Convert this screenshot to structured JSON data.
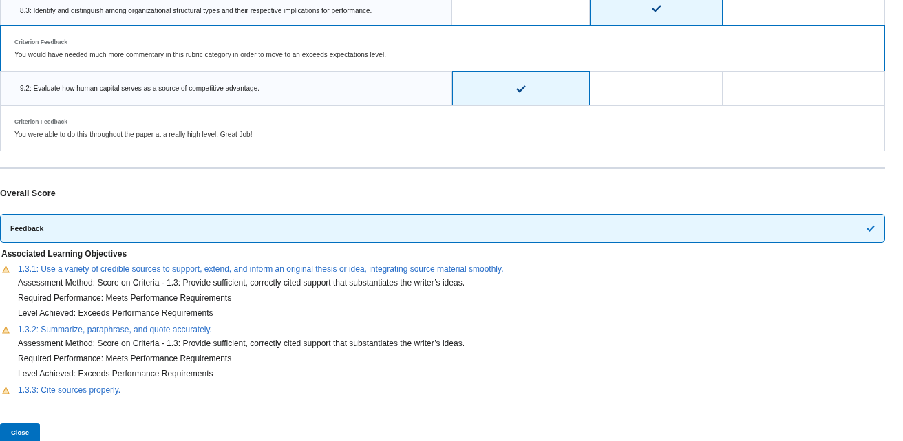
{
  "criteria": [
    {
      "name": "8.3: Identify and distinguish among organizational structural types and their respective implications for performance.",
      "levels": [
        {
          "selected": false
        },
        {
          "selected": true
        },
        {
          "selected": false
        }
      ],
      "feedback_label": "Criterion Feedback",
      "feedback": "You would have needed much more commentary in this rubric category in order to move to an exceeds expectations level.",
      "expanded": true
    },
    {
      "name": "9.2: Evaluate how human capital serves as a source of competitive advantage.",
      "levels": [
        {
          "selected": true
        },
        {
          "selected": false
        },
        {
          "selected": false
        }
      ],
      "feedback_label": "Criterion Feedback",
      "feedback": "You were able to do this throughout the paper at a really high level.  Great Job!",
      "expanded": false
    }
  ],
  "overall_score": {
    "title": "Overall Score"
  },
  "feedback_panel": {
    "label": "Feedback",
    "checked": true
  },
  "objectives": {
    "title": "Associated Learning Objectives",
    "items": [
      {
        "name": "1.3.1: Use a variety of credible sources to support, extend, and inform an original thesis or idea, integrating source material smoothly.",
        "details": [
          "Assessment Method:  Score on Criteria - 1.3: Provide sufficient, correctly cited support that substantiates the writer’s ideas.",
          "Required Performance:  Meets Performance Requirements",
          "Level Achieved:  Exceeds Performance Requirements"
        ]
      },
      {
        "name": "1.3.2: Summarize, paraphrase, and quote accurately.",
        "details": [
          "Assessment Method:  Score on Criteria - 1.3: Provide sufficient, correctly cited support that substantiates the writer’s ideas.",
          "Required Performance:  Meets Performance Requirements",
          "Level Achieved:  Exceeds Performance Requirements"
        ]
      },
      {
        "name": "1.3.3: Cite sources properly."
      }
    ]
  },
  "close_button": "Close"
}
